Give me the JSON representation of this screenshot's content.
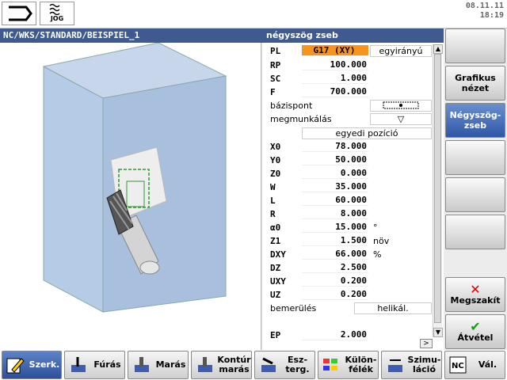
{
  "top": {
    "jog_label": "JOG",
    "date": "08.11.11",
    "time": "18:19"
  },
  "path": "NC/WKS/STANDARD/BEISPIEL_1",
  "form_title": "négyszög zseb",
  "params": [
    {
      "label": "PL",
      "value": "G17 (XY)",
      "extra": "egyirányú"
    },
    {
      "label": "RP",
      "value": "100.000"
    },
    {
      "label": "SC",
      "value": "1.000"
    },
    {
      "label": "F",
      "value": "700.000"
    },
    {
      "label": "bázispont",
      "value": ""
    },
    {
      "label": "megmunkálás",
      "value": "▽"
    },
    {
      "label": "",
      "value": "egyedi pozíció"
    },
    {
      "label": "X0",
      "value": "78.000"
    },
    {
      "label": "Y0",
      "value": "50.000"
    },
    {
      "label": "Z0",
      "value": "0.000"
    },
    {
      "label": "W",
      "value": "35.000"
    },
    {
      "label": "L",
      "value": "60.000"
    },
    {
      "label": "R",
      "value": "8.000"
    },
    {
      "label": "α0",
      "value": "15.000",
      "unit": "°"
    },
    {
      "label": "Z1",
      "value": "1.500",
      "unit": "növ"
    },
    {
      "label": "DXY",
      "value": "66.000",
      "unit": "%"
    },
    {
      "label": "DZ",
      "value": "2.500"
    },
    {
      "label": "UXY",
      "value": "0.200"
    },
    {
      "label": "UZ",
      "value": "0.200"
    },
    {
      "label": "bemerülés",
      "value": "helikál."
    },
    {
      "label": "EP",
      "value": "2.000"
    }
  ],
  "vsoft": {
    "grafikus": "Grafikus\nnézet",
    "negyszog": "Négyszög-\nzseb",
    "megszakit": "Megszakít",
    "atvetel": "Átvétel"
  },
  "hsoft": [
    "Szerk.",
    "Fúrás",
    "Marás",
    "Kontúr\nmarás",
    "Esz-\nterg.",
    "Külön-\nfélék",
    "Szimu-\nláció",
    "Vál."
  ],
  "hscroll": ">"
}
